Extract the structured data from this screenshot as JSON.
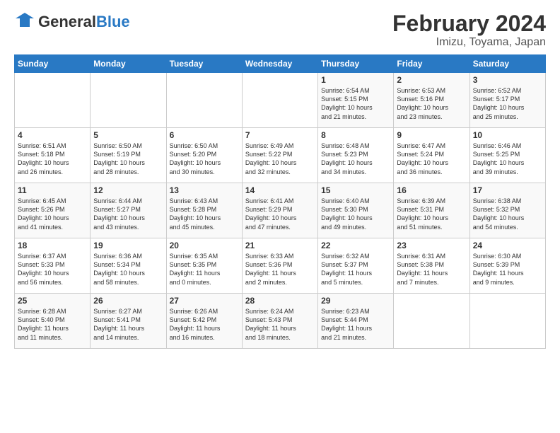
{
  "logo": {
    "general": "General",
    "blue": "Blue"
  },
  "title": "February 2024",
  "subtitle": "Imizu, Toyama, Japan",
  "headers": [
    "Sunday",
    "Monday",
    "Tuesday",
    "Wednesday",
    "Thursday",
    "Friday",
    "Saturday"
  ],
  "weeks": [
    [
      {
        "day": "",
        "info": ""
      },
      {
        "day": "",
        "info": ""
      },
      {
        "day": "",
        "info": ""
      },
      {
        "day": "",
        "info": ""
      },
      {
        "day": "1",
        "info": "Sunrise: 6:54 AM\nSunset: 5:15 PM\nDaylight: 10 hours\nand 21 minutes."
      },
      {
        "day": "2",
        "info": "Sunrise: 6:53 AM\nSunset: 5:16 PM\nDaylight: 10 hours\nand 23 minutes."
      },
      {
        "day": "3",
        "info": "Sunrise: 6:52 AM\nSunset: 5:17 PM\nDaylight: 10 hours\nand 25 minutes."
      }
    ],
    [
      {
        "day": "4",
        "info": "Sunrise: 6:51 AM\nSunset: 5:18 PM\nDaylight: 10 hours\nand 26 minutes."
      },
      {
        "day": "5",
        "info": "Sunrise: 6:50 AM\nSunset: 5:19 PM\nDaylight: 10 hours\nand 28 minutes."
      },
      {
        "day": "6",
        "info": "Sunrise: 6:50 AM\nSunset: 5:20 PM\nDaylight: 10 hours\nand 30 minutes."
      },
      {
        "day": "7",
        "info": "Sunrise: 6:49 AM\nSunset: 5:22 PM\nDaylight: 10 hours\nand 32 minutes."
      },
      {
        "day": "8",
        "info": "Sunrise: 6:48 AM\nSunset: 5:23 PM\nDaylight: 10 hours\nand 34 minutes."
      },
      {
        "day": "9",
        "info": "Sunrise: 6:47 AM\nSunset: 5:24 PM\nDaylight: 10 hours\nand 36 minutes."
      },
      {
        "day": "10",
        "info": "Sunrise: 6:46 AM\nSunset: 5:25 PM\nDaylight: 10 hours\nand 39 minutes."
      }
    ],
    [
      {
        "day": "11",
        "info": "Sunrise: 6:45 AM\nSunset: 5:26 PM\nDaylight: 10 hours\nand 41 minutes."
      },
      {
        "day": "12",
        "info": "Sunrise: 6:44 AM\nSunset: 5:27 PM\nDaylight: 10 hours\nand 43 minutes."
      },
      {
        "day": "13",
        "info": "Sunrise: 6:43 AM\nSunset: 5:28 PM\nDaylight: 10 hours\nand 45 minutes."
      },
      {
        "day": "14",
        "info": "Sunrise: 6:41 AM\nSunset: 5:29 PM\nDaylight: 10 hours\nand 47 minutes."
      },
      {
        "day": "15",
        "info": "Sunrise: 6:40 AM\nSunset: 5:30 PM\nDaylight: 10 hours\nand 49 minutes."
      },
      {
        "day": "16",
        "info": "Sunrise: 6:39 AM\nSunset: 5:31 PM\nDaylight: 10 hours\nand 51 minutes."
      },
      {
        "day": "17",
        "info": "Sunrise: 6:38 AM\nSunset: 5:32 PM\nDaylight: 10 hours\nand 54 minutes."
      }
    ],
    [
      {
        "day": "18",
        "info": "Sunrise: 6:37 AM\nSunset: 5:33 PM\nDaylight: 10 hours\nand 56 minutes."
      },
      {
        "day": "19",
        "info": "Sunrise: 6:36 AM\nSunset: 5:34 PM\nDaylight: 10 hours\nand 58 minutes."
      },
      {
        "day": "20",
        "info": "Sunrise: 6:35 AM\nSunset: 5:35 PM\nDaylight: 11 hours\nand 0 minutes."
      },
      {
        "day": "21",
        "info": "Sunrise: 6:33 AM\nSunset: 5:36 PM\nDaylight: 11 hours\nand 2 minutes."
      },
      {
        "day": "22",
        "info": "Sunrise: 6:32 AM\nSunset: 5:37 PM\nDaylight: 11 hours\nand 5 minutes."
      },
      {
        "day": "23",
        "info": "Sunrise: 6:31 AM\nSunset: 5:38 PM\nDaylight: 11 hours\nand 7 minutes."
      },
      {
        "day": "24",
        "info": "Sunrise: 6:30 AM\nSunset: 5:39 PM\nDaylight: 11 hours\nand 9 minutes."
      }
    ],
    [
      {
        "day": "25",
        "info": "Sunrise: 6:28 AM\nSunset: 5:40 PM\nDaylight: 11 hours\nand 11 minutes."
      },
      {
        "day": "26",
        "info": "Sunrise: 6:27 AM\nSunset: 5:41 PM\nDaylight: 11 hours\nand 14 minutes."
      },
      {
        "day": "27",
        "info": "Sunrise: 6:26 AM\nSunset: 5:42 PM\nDaylight: 11 hours\nand 16 minutes."
      },
      {
        "day": "28",
        "info": "Sunrise: 6:24 AM\nSunset: 5:43 PM\nDaylight: 11 hours\nand 18 minutes."
      },
      {
        "day": "29",
        "info": "Sunrise: 6:23 AM\nSunset: 5:44 PM\nDaylight: 11 hours\nand 21 minutes."
      },
      {
        "day": "",
        "info": ""
      },
      {
        "day": "",
        "info": ""
      }
    ]
  ]
}
